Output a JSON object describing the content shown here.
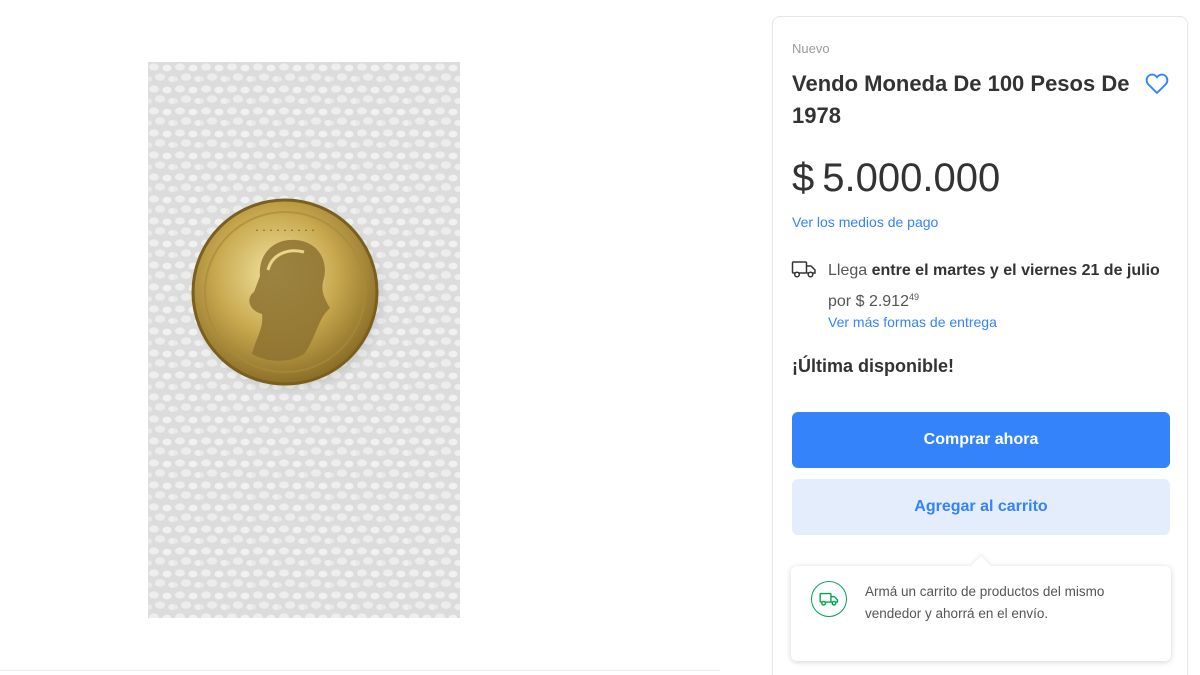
{
  "listing": {
    "condition": "Nuevo",
    "title": "Vendo Moneda De 100 Pesos De 1978",
    "favorite_icon": "heart-outline-icon"
  },
  "price": {
    "symbol": "$",
    "amount": "5.000.000",
    "payment_link": "Ver los medios de pago"
  },
  "shipping": {
    "icon": "truck-icon",
    "prefix": "Llega",
    "between": "entre el",
    "day1": "martes",
    "and": "y el",
    "day2": "viernes",
    "date": "21 de julio",
    "por": "por",
    "cost_symbol": "$",
    "cost": "2.912",
    "cost_cents": "49",
    "more_link": "Ver más formas de entrega"
  },
  "stock": "¡Última disponible!",
  "actions": {
    "buy_now": "Comprar ahora",
    "add_to_cart": "Agregar al carrito"
  },
  "cart_tip": {
    "icon": "cart-truck-icon",
    "text": "Armá un carrito de productos del mismo vendedor y ahorrá en el envío."
  },
  "colors": {
    "accent": "#3483fa",
    "secondary_button_bg": "#e3edfb",
    "success_green": "#00a650"
  }
}
